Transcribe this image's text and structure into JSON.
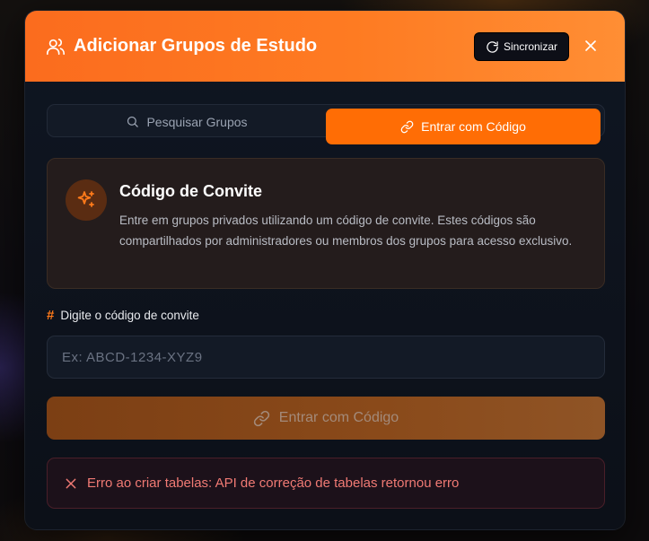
{
  "modal": {
    "title": "Adicionar Grupos de Estudo",
    "sync_label": "Sincronizar"
  },
  "tabs": [
    {
      "label": "Pesquisar Grupos",
      "active": false,
      "icon": "search-icon"
    },
    {
      "label": "Entrar com Código",
      "active": true,
      "icon": "link-icon"
    }
  ],
  "info": {
    "title": "Código de Convite",
    "description": "Entre em grupos privados utilizando um código de convite. Estes códigos são compartilhados por administradores ou membros dos grupos para acesso exclusivo.",
    "icon": "sparkles-icon"
  },
  "field": {
    "label": "Digite o código de convite",
    "value": "",
    "placeholder": "Ex: ABCD-1234-XYZ9"
  },
  "submit": {
    "label": "Entrar com Código",
    "disabled": true
  },
  "error": {
    "message": "Erro ao criar tabelas: API de correção de tabelas retornou erro"
  },
  "colors": {
    "accent": "#ff6d05",
    "header_gradient_start": "#fb6c1e",
    "header_gradient_end": "#ff8e34",
    "error_text": "#f07a74",
    "panel_bg": "#0f1622"
  }
}
